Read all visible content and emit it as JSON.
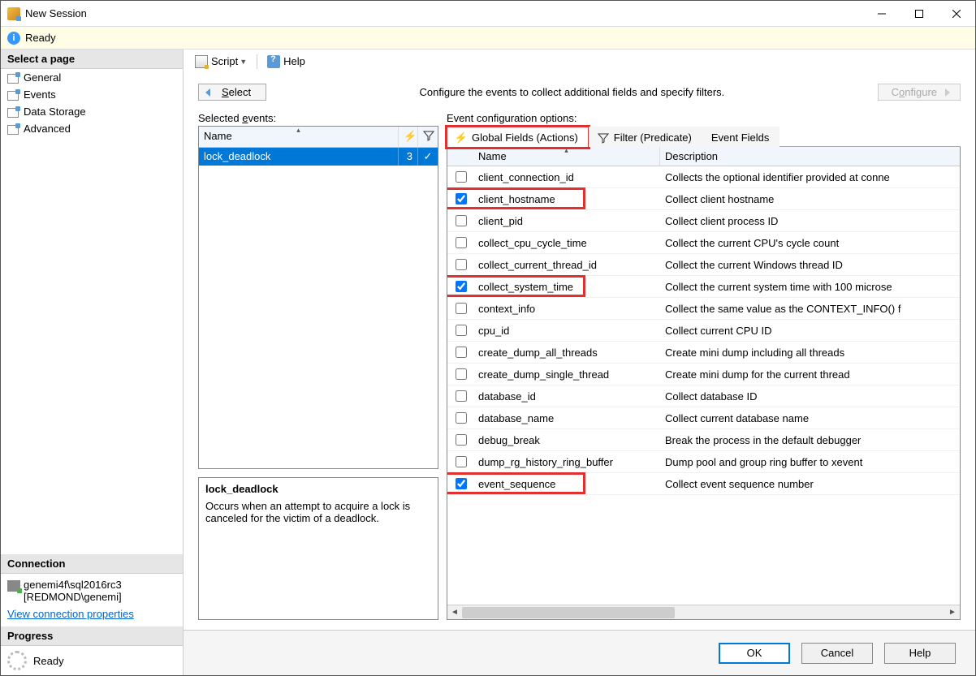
{
  "window": {
    "title": "New Session"
  },
  "status": {
    "text": "Ready"
  },
  "sidebar": {
    "header": "Select a page",
    "pages": [
      {
        "label": "General"
      },
      {
        "label": "Events"
      },
      {
        "label": "Data Storage"
      },
      {
        "label": "Advanced"
      }
    ],
    "selected_index": 1,
    "connection": {
      "header": "Connection",
      "server": "genemi4f\\sql2016rc3",
      "user": "[REDMOND\\genemi]",
      "link": "View connection properties"
    },
    "progress": {
      "header": "Progress",
      "text": "Ready"
    }
  },
  "toolbar": {
    "script": "Script",
    "help": "Help"
  },
  "main": {
    "select_button": "Select",
    "instruction": "Configure the events to collect additional fields and specify filters.",
    "configure_button": "Configure",
    "selected_events": {
      "label_pre": "Selected ",
      "label_u": "e",
      "label_post": "vents:",
      "col_name": "Name",
      "rows": [
        {
          "name": "lock_deadlock",
          "count": "3",
          "checked": true
        }
      ]
    },
    "description": {
      "title": "lock_deadlock",
      "body": "Occurs when an attempt to acquire a lock is canceled for the victim of a deadlock."
    },
    "config": {
      "label": "Event configuration options:",
      "tabs": [
        {
          "label": "Global Fields (Actions)",
          "icon": "bolt",
          "active": true,
          "highlight": true
        },
        {
          "label": "Filter (Predicate)",
          "icon": "funnel",
          "active": false
        },
        {
          "label": "Event Fields",
          "icon": "",
          "active": false
        }
      ],
      "columns": {
        "name": "Name",
        "description": "Description"
      },
      "fields": [
        {
          "checked": false,
          "name": "client_connection_id",
          "desc": "Collects the optional identifier provided at conne",
          "highlight": false
        },
        {
          "checked": true,
          "name": "client_hostname",
          "desc": "Collect client hostname",
          "highlight": true
        },
        {
          "checked": false,
          "name": "client_pid",
          "desc": "Collect client process ID",
          "highlight": false
        },
        {
          "checked": false,
          "name": "collect_cpu_cycle_time",
          "desc": "Collect the current CPU's cycle count",
          "highlight": false
        },
        {
          "checked": false,
          "name": "collect_current_thread_id",
          "desc": "Collect the current Windows thread ID",
          "highlight": false
        },
        {
          "checked": true,
          "name": "collect_system_time",
          "desc": "Collect the current system time with 100 microse",
          "highlight": true
        },
        {
          "checked": false,
          "name": "context_info",
          "desc": "Collect the same value as the CONTEXT_INFO() f",
          "highlight": false
        },
        {
          "checked": false,
          "name": "cpu_id",
          "desc": "Collect current CPU ID",
          "highlight": false
        },
        {
          "checked": false,
          "name": "create_dump_all_threads",
          "desc": "Create mini dump including all threads",
          "highlight": false
        },
        {
          "checked": false,
          "name": "create_dump_single_thread",
          "desc": "Create mini dump for the current thread",
          "highlight": false
        },
        {
          "checked": false,
          "name": "database_id",
          "desc": "Collect database ID",
          "highlight": false
        },
        {
          "checked": false,
          "name": "database_name",
          "desc": "Collect current database name",
          "highlight": false
        },
        {
          "checked": false,
          "name": "debug_break",
          "desc": "Break the process in the default debugger",
          "highlight": false
        },
        {
          "checked": false,
          "name": "dump_rg_history_ring_buffer",
          "desc": "Dump pool and group ring buffer to xevent",
          "highlight": false
        },
        {
          "checked": true,
          "name": "event_sequence",
          "desc": "Collect event sequence number",
          "highlight": true
        }
      ]
    }
  },
  "footer": {
    "ok": "OK",
    "cancel": "Cancel",
    "help": "Help"
  }
}
